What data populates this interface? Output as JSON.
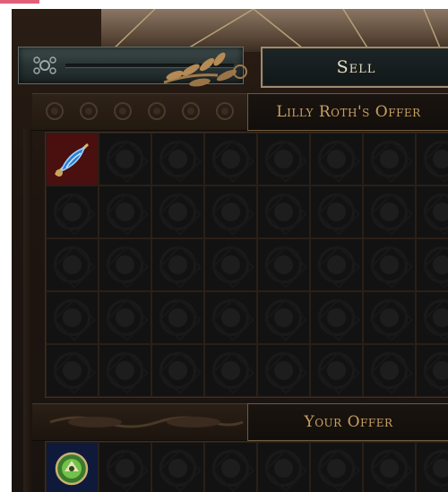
{
  "sell_button": {
    "label": "Sell"
  },
  "trade": {
    "their_offer_title": "Lilly Roth's Offer",
    "your_offer_title": "Your Offer",
    "their_grid": {
      "columns": 8,
      "rows": 5
    },
    "your_grid": {
      "columns": 8,
      "rows": 1
    },
    "their_items": [
      {
        "name": "blue-feather-item-icon",
        "column": 1,
        "row": 1,
        "frame_color": "#4a0f0f"
      }
    ],
    "your_items": [
      {
        "name": "green-amulet-item-icon",
        "column": 1,
        "row": 1,
        "frame_color": "#0f1a3a"
      }
    ]
  },
  "colors": {
    "title_gold": "#c9a060",
    "button_text": "#e8dcc0",
    "frame_border": "#9d8a6e"
  }
}
